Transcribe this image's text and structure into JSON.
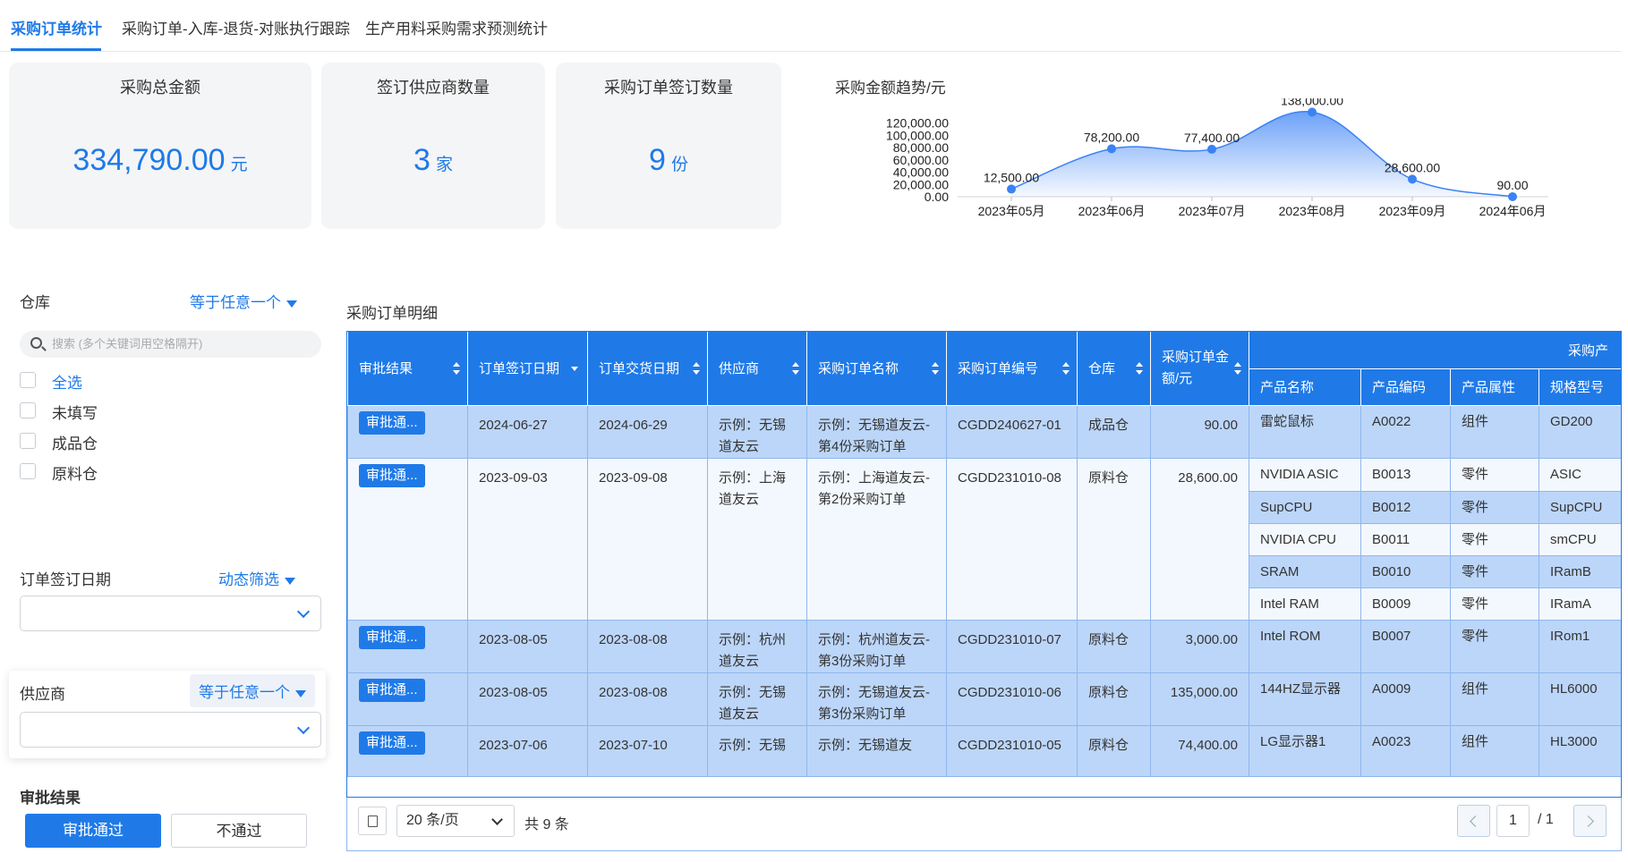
{
  "tabs": [
    {
      "label": "采购订单统计",
      "active": true
    },
    {
      "label": "采购订单-入库-退货-对账执行跟踪",
      "active": false
    },
    {
      "label": "生产用料采购需求预测统计",
      "active": false
    }
  ],
  "cards": [
    {
      "title": "采购总金额",
      "value": "334,790.00",
      "unit": "元"
    },
    {
      "title": "签订供应商数量",
      "value": "3",
      "unit": "家"
    },
    {
      "title": "采购订单签订数量",
      "value": "9",
      "unit": "份"
    }
  ],
  "chart_title": "采购金额趋势/元",
  "chart_data": {
    "type": "area",
    "title": "采购金额趋势/元",
    "categories": [
      "2023年05月",
      "2023年06月",
      "2023年07月",
      "2023年08月",
      "2023年09月",
      "2024年06月"
    ],
    "values": [
      12500,
      78200,
      77400,
      138000,
      28600,
      90
    ],
    "value_labels": [
      "12,500.00",
      "78,200.00",
      "77,400.00",
      "138,000.00",
      "28,600.00",
      "90.00"
    ],
    "y_ticks": [
      "0.00",
      "20,000.00",
      "40,000.00",
      "60,000.00",
      "80,000.00",
      "100,000.00",
      "120,000.00"
    ],
    "ylim": [
      0,
      140000
    ],
    "color": "#3b82f6"
  },
  "filters": {
    "warehouse": {
      "label": "仓库",
      "mode": "等于任意一个",
      "search_placeholder": "搜索 (多个关键词用空格隔开)",
      "options": [
        "全选",
        "未填写",
        "成品仓",
        "原料仓"
      ]
    },
    "order_date": {
      "label": "订单签订日期",
      "mode": "动态筛选"
    },
    "supplier": {
      "label": "供应商",
      "mode": "等于任意一个"
    },
    "approval": {
      "label": "审批结果",
      "pass_label": "审批通过",
      "reject_label": "不通过"
    }
  },
  "table": {
    "title": "采购订单明细",
    "group_header": "采购产",
    "headers": [
      "审批结果",
      "订单签订日期",
      "订单交货日期",
      "供应商",
      "采购订单名称",
      "采购订单编号",
      "仓库",
      "采购订单金额/元",
      "产品名称",
      "产品编码",
      "产品属性",
      "规格型号",
      "采"
    ],
    "rows": [
      {
        "status": "审批通...",
        "sign": "2024-06-27",
        "deliver": "2024-06-29",
        "supplier": "示例：无锡道友云",
        "name": "示例：无锡道友云-第4份采购订单",
        "code": "CGDD240627-01",
        "wh": "成品仓",
        "amount": "90.00",
        "products": [
          {
            "pname": "雷蛇鼠标",
            "pcode": "A0022",
            "attr": "组件",
            "spec": "GD200"
          }
        ]
      },
      {
        "status": "审批通...",
        "sign": "2023-09-03",
        "deliver": "2023-09-08",
        "supplier": "示例：上海道友云",
        "name": "示例：上海道友云-第2份采购订单",
        "code": "CGDD231010-08",
        "wh": "原料仓",
        "amount": "28,600.00",
        "products": [
          {
            "pname": "NVIDIA ASIC",
            "pcode": "B0013",
            "attr": "零件",
            "spec": "ASIC"
          },
          {
            "pname": "SupCPU",
            "pcode": "B0012",
            "attr": "零件",
            "spec": "SupCPU"
          },
          {
            "pname": "NVIDIA CPU",
            "pcode": "B0011",
            "attr": "零件",
            "spec": "smCPU"
          },
          {
            "pname": "SRAM",
            "pcode": "B0010",
            "attr": "零件",
            "spec": "IRamB"
          },
          {
            "pname": "Intel RAM",
            "pcode": "B0009",
            "attr": "零件",
            "spec": "IRamA"
          }
        ]
      },
      {
        "status": "审批通...",
        "sign": "2023-08-05",
        "deliver": "2023-08-08",
        "supplier": "示例：杭州道友云",
        "name": "示例：杭州道友云-第3份采购订单",
        "code": "CGDD231010-07",
        "wh": "原料仓",
        "amount": "3,000.00",
        "products": [
          {
            "pname": "Intel ROM",
            "pcode": "B0007",
            "attr": "零件",
            "spec": "IRom1"
          }
        ]
      },
      {
        "status": "审批通...",
        "sign": "2023-08-05",
        "deliver": "2023-08-08",
        "supplier": "示例：无锡道友云",
        "name": "示例：无锡道友云-第3份采购订单",
        "code": "CGDD231010-06",
        "wh": "原料仓",
        "amount": "135,000.00",
        "products": [
          {
            "pname": "144HZ显示器",
            "pcode": "A0009",
            "attr": "组件",
            "spec": "HL6000"
          }
        ]
      },
      {
        "status": "审批通...",
        "sign": "2023-07-06",
        "deliver": "2023-07-10",
        "supplier": "示例：无锡",
        "name": "示例：无锡道友",
        "code": "CGDD231010-05",
        "wh": "原料仓",
        "amount": "74,400.00",
        "products": [
          {
            "pname": "LG显示器1",
            "pcode": "A0023",
            "attr": "组件",
            "spec": "HL3000"
          }
        ]
      }
    ]
  },
  "pager": {
    "page_size": "20 条/页",
    "total": "共 9 条",
    "current": "1",
    "of": "/ 1"
  }
}
